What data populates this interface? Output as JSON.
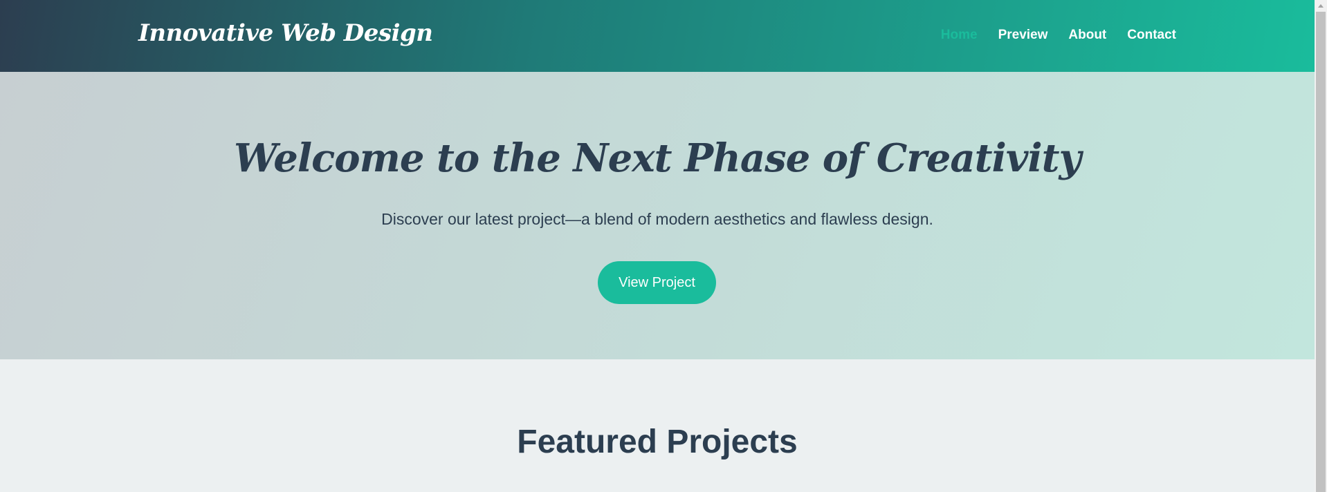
{
  "header": {
    "logo": "Innovative Web Design",
    "nav": [
      {
        "label": "Home",
        "active": true
      },
      {
        "label": "Preview",
        "active": false
      },
      {
        "label": "About",
        "active": false
      },
      {
        "label": "Contact",
        "active": false
      }
    ]
  },
  "hero": {
    "title": "Welcome to the Next Phase of Creativity",
    "subtitle": "Discover our latest project—a blend of modern aesthetics and flawless design.",
    "button_label": "View Project"
  },
  "featured": {
    "title": "Featured Projects"
  },
  "colors": {
    "accent": "#1abc9c",
    "dark": "#2c3e50",
    "page_bg": "#ecf0f1"
  }
}
